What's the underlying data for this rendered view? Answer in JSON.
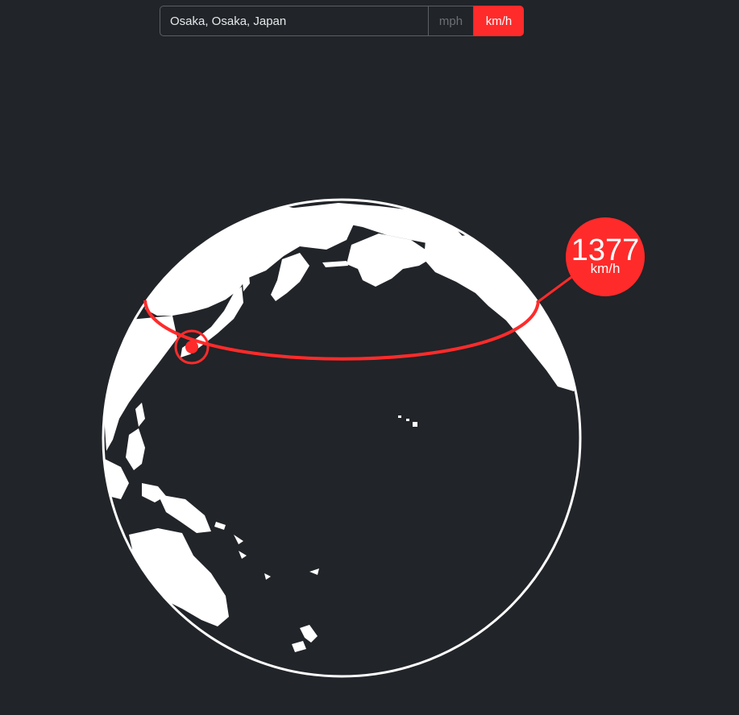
{
  "search": {
    "location_value": "Osaka, Osaka, Japan"
  },
  "units": {
    "mph_label": "mph",
    "kmh_label": "km/h",
    "selected": "km/h"
  },
  "speed": {
    "value": "1377",
    "unit": "km/h"
  },
  "colors": {
    "background": "#212428",
    "accent": "#ff2b2b",
    "land": "#ffffff"
  },
  "icons": {
    "location_marker": "location-marker-icon"
  }
}
